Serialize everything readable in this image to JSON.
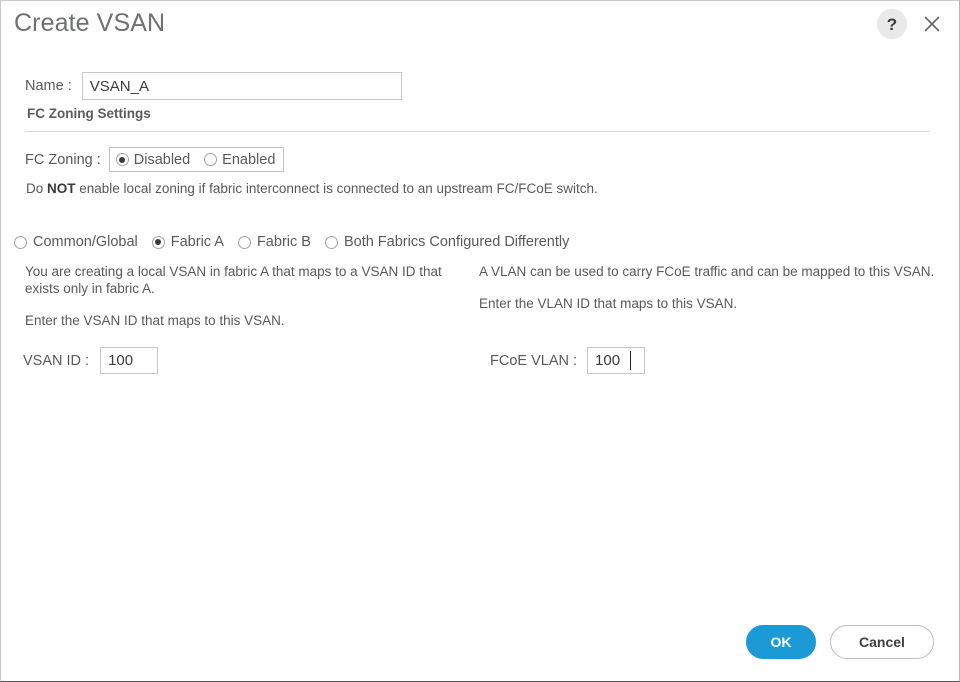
{
  "dialog": {
    "title": "Create VSAN",
    "help_icon_label": "?",
    "close_icon_name": "close"
  },
  "form": {
    "name_label": "Name :",
    "name_value": "VSAN_A",
    "name_placeholder": "",
    "section_heading": "FC Zoning Settings",
    "fc_zoning_label": "FC Zoning :",
    "fc_zoning_options": [
      {
        "label": "Disabled",
        "selected": true
      },
      {
        "label": "Enabled",
        "selected": false
      }
    ],
    "note_prefix": "Do ",
    "note_bold": "NOT",
    "note_suffix": " enable local zoning if fabric interconnect is connected to an upstream FC/FCoE switch.",
    "fabric_options": [
      {
        "label": "Common/Global",
        "selected": false
      },
      {
        "label": "Fabric A",
        "selected": true
      },
      {
        "label": "Fabric B",
        "selected": false
      },
      {
        "label": "Both Fabrics Configured Differently",
        "selected": false
      }
    ],
    "left_column": {
      "description": "You are creating a local VSAN in fabric A that maps to a VSAN ID that exists only in fabric A.",
      "instruction": "Enter the VSAN ID that maps to this VSAN."
    },
    "right_column": {
      "description": "A VLAN can be used to carry FCoE traffic and can be mapped to this VSAN.",
      "instruction": "Enter the VLAN ID that maps to this VSAN."
    },
    "vsan_id_label": "VSAN ID :",
    "vsan_id_value": "100",
    "fcoe_vlan_label": "FCoE VLAN :",
    "fcoe_vlan_value": "100"
  },
  "footer": {
    "ok_label": "OK",
    "cancel_label": "Cancel"
  },
  "colors": {
    "primary_button": "#1c9ad6",
    "text": "#58595b",
    "title": "#6f7072",
    "border": "#c7c7c7"
  }
}
